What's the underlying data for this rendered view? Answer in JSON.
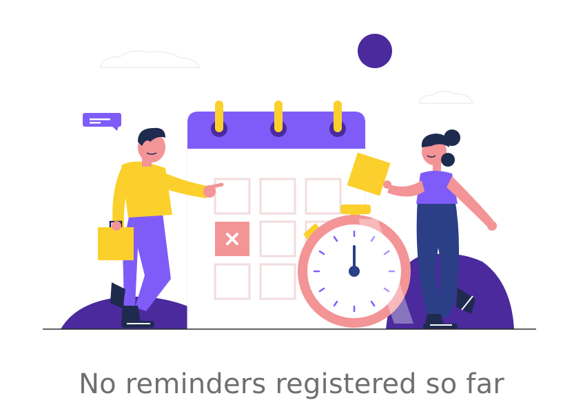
{
  "empty_state": {
    "message": "No reminders registered so far",
    "illustration": {
      "subject": "calendar-with-people-and-stopwatch",
      "colors": {
        "purple": "#7f5cf8",
        "dark_purple": "#4a2a9d",
        "yellow": "#fbd02c",
        "navy": "#2a3f86",
        "pink": "#f39496",
        "light_pink": "#f8d9dc",
        "grid_cell": "#f2dcde"
      }
    }
  }
}
